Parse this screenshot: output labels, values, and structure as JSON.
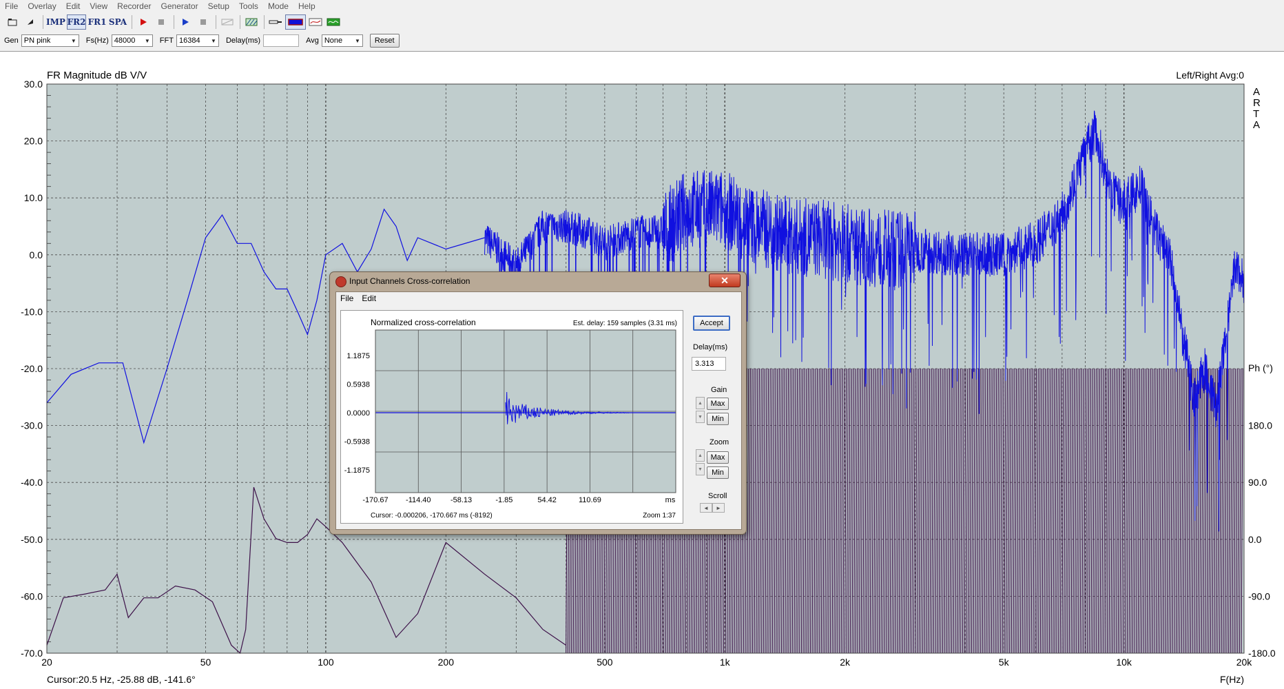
{
  "menu": [
    "File",
    "Overlay",
    "Edit",
    "View",
    "Recorder",
    "Generator",
    "Setup",
    "Tools",
    "Mode",
    "Help"
  ],
  "toolbar": {
    "imp_label": "IMP",
    "fr2_label": "FR2",
    "fr1_label": "FR1",
    "spa_label": "SPA"
  },
  "genbar": {
    "gen_label": "Gen",
    "gen_value": "PN pink",
    "fs_label": "Fs(Hz)",
    "fs_value": "48000",
    "fft_label": "FFT",
    "fft_value": "16384",
    "delay_label": "Delay(ms)",
    "delay_value": "",
    "avg_label": "Avg",
    "avg_value": "None",
    "reset_label": "Reset"
  },
  "plot": {
    "title": "FR Magnitude dB V/V",
    "top_right": "Left/Right  Avg:0",
    "brand": [
      "A",
      "R",
      "T",
      "A"
    ],
    "phase_label": "Ph (°)",
    "x_label": "F(Hz)",
    "cursor": "Cursor:20.5 Hz, -25.88 dB, -141.6°",
    "y_ticks": [
      "30.0",
      "20.0",
      "10.0",
      "0.0",
      "-10.0",
      "-20.0",
      "-30.0",
      "-40.0",
      "-50.0",
      "-60.0",
      "-70.0"
    ],
    "phase_ticks": [
      "180.0",
      "90.0",
      "0.0",
      "-90.0",
      "-180.0"
    ],
    "x_ticks": [
      {
        "hz": 20,
        "label": "20"
      },
      {
        "hz": 50,
        "label": "50"
      },
      {
        "hz": 100,
        "label": "100"
      },
      {
        "hz": 200,
        "label": "200"
      },
      {
        "hz": 500,
        "label": "500"
      },
      {
        "hz": 1000,
        "label": "1k"
      },
      {
        "hz": 2000,
        "label": "2k"
      },
      {
        "hz": 5000,
        "label": "5k"
      },
      {
        "hz": 10000,
        "label": "10k"
      },
      {
        "hz": 20000,
        "label": "20k"
      }
    ],
    "colors": {
      "background": "#c0cdcd",
      "magnitude": "#1010e0",
      "phase": "#3c1048",
      "grid": "#4a4a4a"
    }
  },
  "chart_data": {
    "type": "line",
    "title": "FR Magnitude dB V/V",
    "xlabel": "F(Hz)",
    "ylabel": "",
    "x_scale": "log",
    "xlim": [
      20,
      20000
    ],
    "ylim": [
      -70,
      30
    ],
    "y2lim": [
      -180,
      180
    ],
    "grid": true,
    "series": [
      {
        "axis": "left",
        "x": [
          20,
          23,
          27,
          31,
          35,
          40,
          45,
          50,
          55,
          60,
          65,
          70,
          75,
          80,
          85,
          90,
          95,
          100,
          110,
          120,
          130,
          140,
          150,
          160,
          170,
          200,
          250,
          300,
          350,
          400,
          450,
          500,
          600,
          700,
          800,
          900,
          1000,
          1200,
          1500,
          1700,
          2000,
          2500,
          3000,
          4000,
          5000,
          6000,
          7000,
          8000,
          8500,
          9000,
          9500,
          10000,
          11000,
          12000,
          13000,
          14000,
          15000,
          16000,
          17000,
          18000,
          19000,
          20000
        ],
        "y": [
          -26,
          -21,
          -19,
          -19,
          -33,
          -20,
          -8,
          3,
          7,
          2,
          2,
          -3,
          -6,
          -6,
          -10,
          -14,
          -8,
          0,
          2,
          -3,
          1,
          8,
          5,
          -1,
          3,
          1,
          3,
          -2,
          5,
          5,
          4,
          2,
          4,
          4,
          8,
          8,
          8,
          5,
          3,
          3,
          2,
          1,
          1,
          0,
          0,
          2,
          7,
          18,
          22,
          14,
          10,
          9,
          12,
          4,
          0,
          -14,
          -25,
          -20,
          -27,
          -15,
          -2,
          -5
        ]
      },
      {
        "axis": "right",
        "x": [
          20,
          22,
          25,
          28,
          30,
          32,
          35,
          38,
          42,
          47,
          52,
          58,
          61,
          63,
          66,
          70,
          75,
          80,
          85,
          90,
          95,
          100,
          110,
          130,
          150,
          170,
          200,
          250,
          300,
          350,
          400
        ],
        "y": [
          -170,
          -110,
          -105,
          -100,
          -80,
          -135,
          -110,
          -110,
          -95,
          -100,
          -115,
          -170,
          -180,
          -150,
          30,
          -10,
          -35,
          -40,
          -40,
          -30,
          -10,
          -20,
          -40,
          -90,
          -160,
          -130,
          -40,
          -80,
          -110,
          -150,
          -170
        ]
      }
    ]
  },
  "dialog": {
    "title": "Input Channels Cross-correlation",
    "menu": [
      "File",
      "Edit"
    ],
    "panel_title": "Normalized cross-correlation",
    "est_delay": "Est. delay: 159 samples (3.31 ms)",
    "y_ticks": [
      "1.1875",
      "0.5938",
      "0.0000",
      "-0.5938",
      "-1.1875"
    ],
    "x_ticks": [
      "-170.67",
      "-114.40",
      "-58.13",
      "-1.85",
      "54.42",
      "110.69",
      "ms"
    ],
    "cursor": "Cursor: -0.000206, -170.667 ms  (-8192)",
    "zoom": "Zoom 1:37",
    "accept_label": "Accept",
    "delay_label": "Delay(ms)",
    "delay_value": "3.313",
    "gain_label": "Gain",
    "zoom_label": "Zoom",
    "max_label": "Max",
    "min_label": "Min",
    "scroll_label": "Scroll",
    "close_glyph": "✕"
  }
}
